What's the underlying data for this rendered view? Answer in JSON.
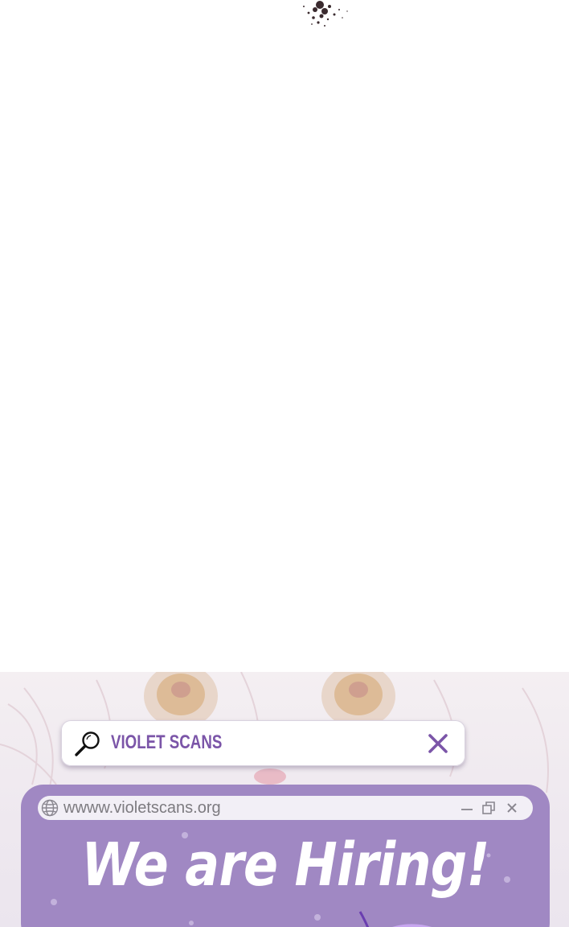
{
  "search": {
    "query": "VIOLET SCANS",
    "icon": "magnifier-icon",
    "close_icon": "close-x-icon"
  },
  "hiring_window": {
    "url": "wwww.violetscans.org",
    "title": "We are Hiring!",
    "controls": [
      "minimize-icon",
      "restore-icon",
      "close-icon"
    ],
    "close_label": "X"
  },
  "colors": {
    "brand_purple": "#7b55a8",
    "window_bg": "#a088c3",
    "address_bg": "#f2eff6"
  }
}
